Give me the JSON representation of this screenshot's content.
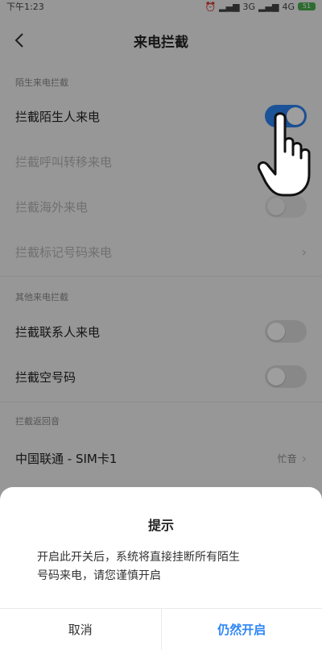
{
  "status_bar": {
    "time": "下午1:23",
    "signal_1": "3G",
    "signal_2": "4G",
    "battery": "51"
  },
  "header": {
    "back_icon": "chevron-left-icon",
    "title": "来电拦截"
  },
  "sections": {
    "stranger": {
      "label": "陌生来电拦截",
      "items": [
        {
          "label": "拦截陌生人来电",
          "control": "toggle",
          "state": "on",
          "enabled": true
        },
        {
          "label": "拦截呼叫转移来电",
          "control": "none",
          "enabled": false
        },
        {
          "label": "拦截海外来电",
          "control": "toggle",
          "state": "off",
          "enabled": false
        },
        {
          "label": "拦截标记号码来电",
          "control": "chevron",
          "enabled": false
        }
      ]
    },
    "other": {
      "label": "其他来电拦截",
      "items": [
        {
          "label": "拦截联系人来电",
          "control": "toggle",
          "state": "off",
          "enabled": true
        },
        {
          "label": "拦截空号码",
          "control": "toggle",
          "state": "off",
          "enabled": true
        }
      ]
    },
    "ringback": {
      "label": "拦截返回音",
      "items": [
        {
          "label": "中国联通 - SIM卡1",
          "value": "忙音",
          "control": "chevron",
          "enabled": true
        }
      ]
    }
  },
  "dialog": {
    "title": "提示",
    "message_line1": "开启此开关后，系统将直接挂断所有陌生",
    "message_line2": "号码来电，请您谨慎开启",
    "cancel_label": "取消",
    "confirm_label": "仍然开启"
  },
  "colors": {
    "accent": "#2e86f5",
    "battery": "#4caf50"
  }
}
